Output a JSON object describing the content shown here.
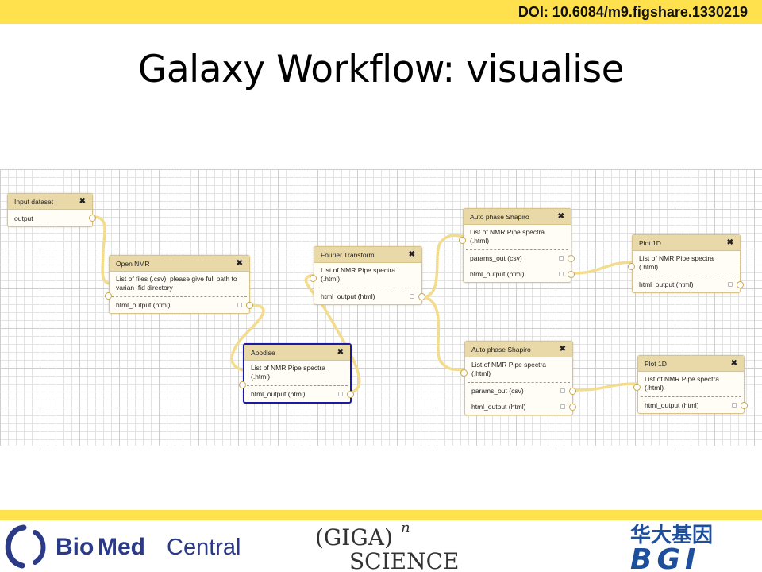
{
  "header": {
    "doi": "DOI: 10.6084/m9.figshare.1330219"
  },
  "title": "Galaxy Workflow: visualise",
  "workflow": {
    "nodes": {
      "input_dataset": {
        "title": "Input dataset",
        "output": "output"
      },
      "open_nmr": {
        "title": "Open NMR",
        "input": "List of files (.csv), please give full path to varian .fid directory",
        "output": "html_output (html)"
      },
      "apodise": {
        "title": "Apodise",
        "input": "List of NMR Pipe spectra (.html)",
        "output": "html_output (html)"
      },
      "fourier": {
        "title": "Fourier Transform",
        "input": "List of NMR Pipe spectra (.html)",
        "output": "html_output (html)"
      },
      "autophase_top": {
        "title": "Auto phase Shapiro",
        "input": "List of NMR Pipe spectra (.html)",
        "output1": "params_out (csv)",
        "output2": "html_output (html)"
      },
      "autophase_bottom": {
        "title": "Auto phase Shapiro",
        "input": "List of NMR Pipe spectra (.html)",
        "output1": "params_out (csv)",
        "output2": "html_output (html)"
      },
      "plot_top": {
        "title": "Plot 1D",
        "input": "List of NMR Pipe spectra (.html)",
        "output": "html_output (html)"
      },
      "plot_bottom": {
        "title": "Plot 1D",
        "input": "List of NMR Pipe spectra (.html)",
        "output": "html_output (html)"
      }
    },
    "close_icon": "close-icon"
  },
  "footer": {
    "logo_bmc": {
      "bio": "Bio",
      "med": "Med",
      "central": "Central"
    },
    "logo_giga": {
      "giga": "(GIGA)",
      "exp": "n",
      "science": "SCIENCE"
    },
    "logo_bgi": {
      "chinese": "华大基因",
      "latin": "BGI"
    }
  },
  "colors": {
    "accent_yellow": "#ffe14d",
    "node_header": "#ead9a8",
    "connector": "#f3dc8c",
    "selected_border": "#1a1aa6",
    "bmc_blue": "#2a3a86"
  }
}
